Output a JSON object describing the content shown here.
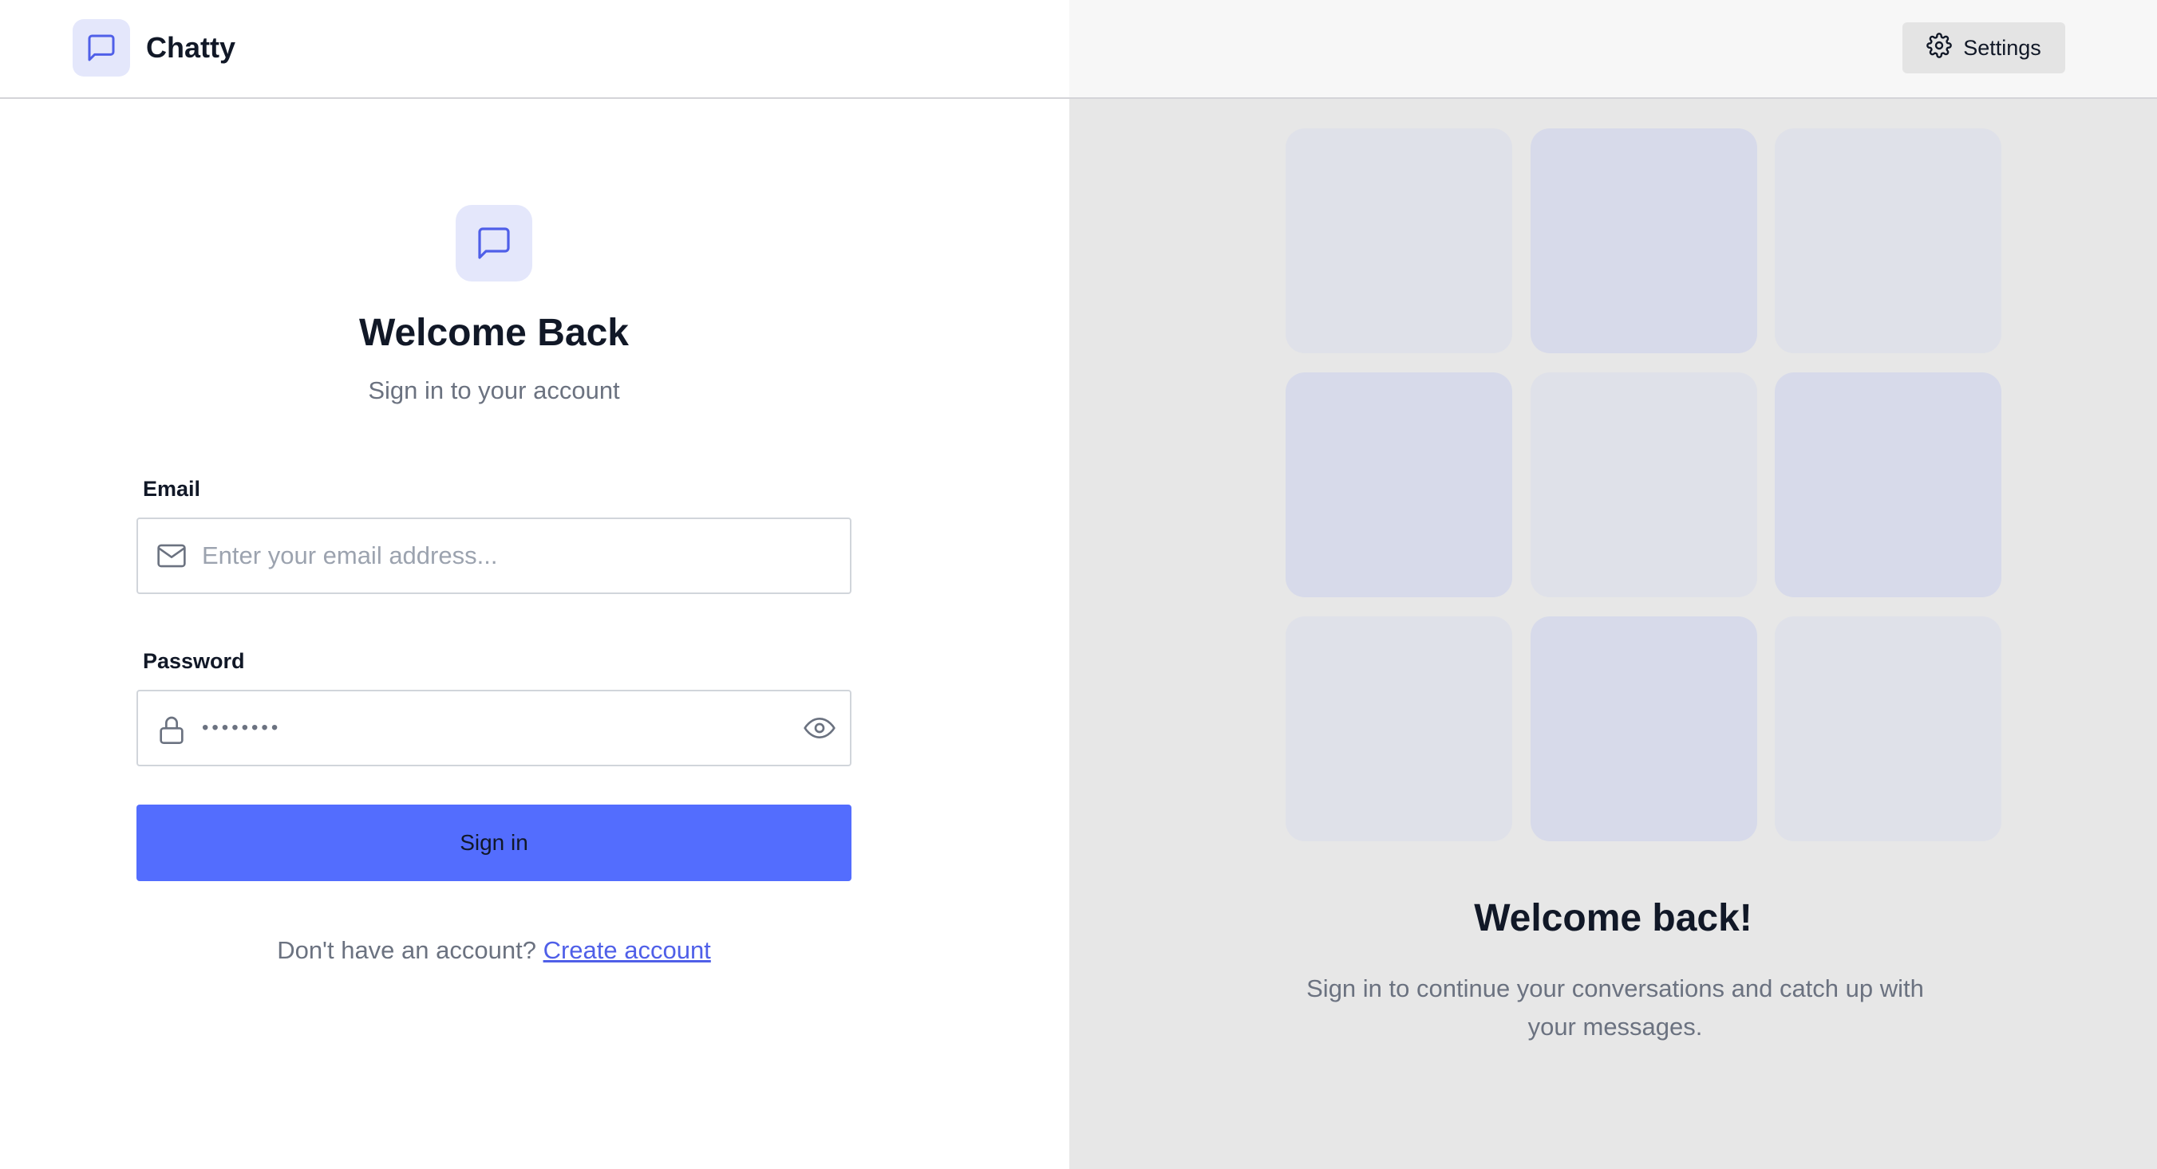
{
  "header": {
    "app_name": "Chatty",
    "settings_label": "Settings"
  },
  "login": {
    "title": "Welcome Back",
    "subtitle": "Sign in to your account",
    "email_label": "Email",
    "email_placeholder": "Enter your email address...",
    "password_label": "Password",
    "password_value": "••••••••",
    "submit_label": "Sign in",
    "signup_prompt": "Don't have an account? ",
    "signup_link": "Create account"
  },
  "promo": {
    "title": "Welcome back!",
    "text": "Sign in to continue your conversations and catch up with your messages."
  },
  "icons": {
    "brand": "message-square-icon",
    "settings": "gear-icon",
    "email": "mail-icon",
    "password": "lock-icon",
    "toggle": "eye-icon"
  },
  "colors": {
    "accent": "#536dfe",
    "link": "#4f5fe8",
    "icon_bg": "#e4e7fb",
    "tile_light": "#dfe1e9",
    "tile_dark": "#d7daea"
  }
}
